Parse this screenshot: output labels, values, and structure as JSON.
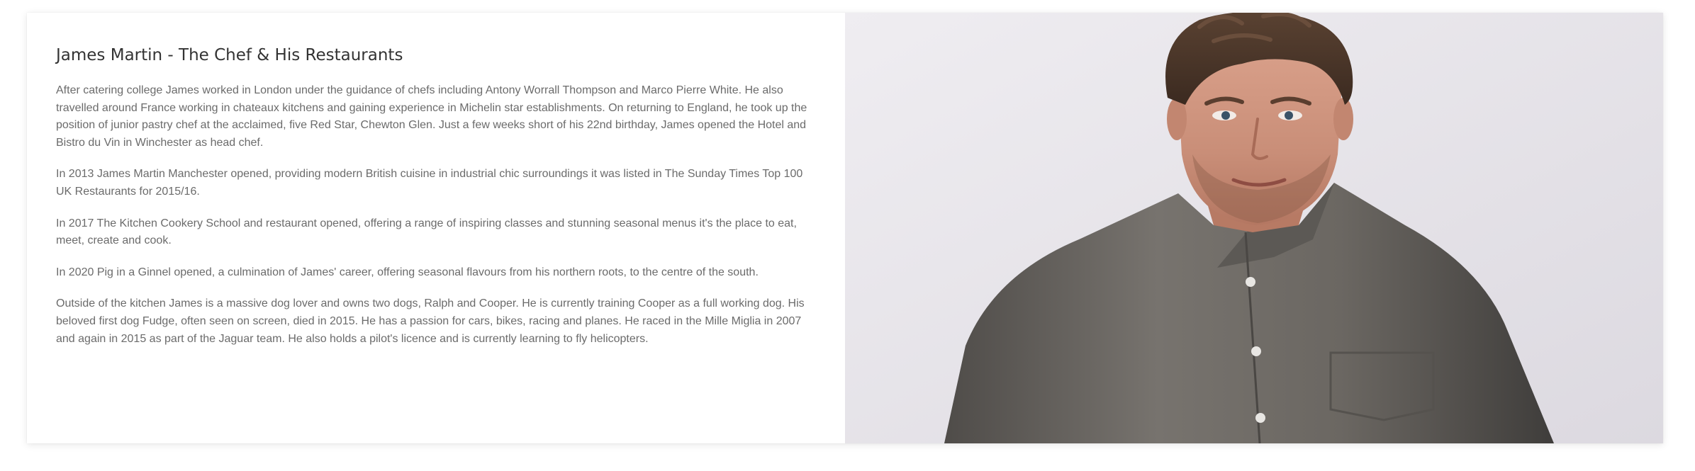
{
  "article": {
    "title": "James Martin - The Chef & His Restaurants",
    "paragraphs": [
      "After catering college James worked in London under the guidance of chefs including Antony Worrall Thompson and Marco Pierre White. He also travelled around France working in chateaux kitchens and gaining experience in Michelin star establishments. On returning to England, he took up the position of junior pastry chef at the acclaimed, five Red Star, Chewton Glen. Just a few weeks short of his 22nd birthday, James opened the Hotel and Bistro du Vin in Winchester as head chef.",
      "In 2013 James Martin Manchester opened, providing modern British cuisine in industrial chic surroundings it was listed in The Sunday Times Top 100 UK Restaurants for 2015/16.",
      "In 2017 The Kitchen Cookery School and restaurant opened, offering a range of inspiring classes and stunning seasonal menus it's the place to eat, meet, create and cook.",
      "In 2020 Pig in a Ginnel opened, a culmination of James' career, offering seasonal flavours from his northern roots, to the centre of the south.",
      "Outside of the kitchen James is a massive dog lover and owns two dogs, Ralph and Cooper. He is currently training Cooper as a full working dog. His beloved first dog Fudge, often seen on screen, died in 2015. He has a passion for cars, bikes, racing and planes. He raced in the Mille Miglia in 2007 and again in 2015 as part of the Jaguar team. He also holds a pilot's licence and is currently learning to fly helicopters."
    ]
  },
  "photo": {
    "subject": "chef-portrait",
    "colors": {
      "background": "#e6e4ea",
      "shirt": "#6d6a66",
      "skin": "#c98e78",
      "hair": "#4a3528"
    }
  }
}
